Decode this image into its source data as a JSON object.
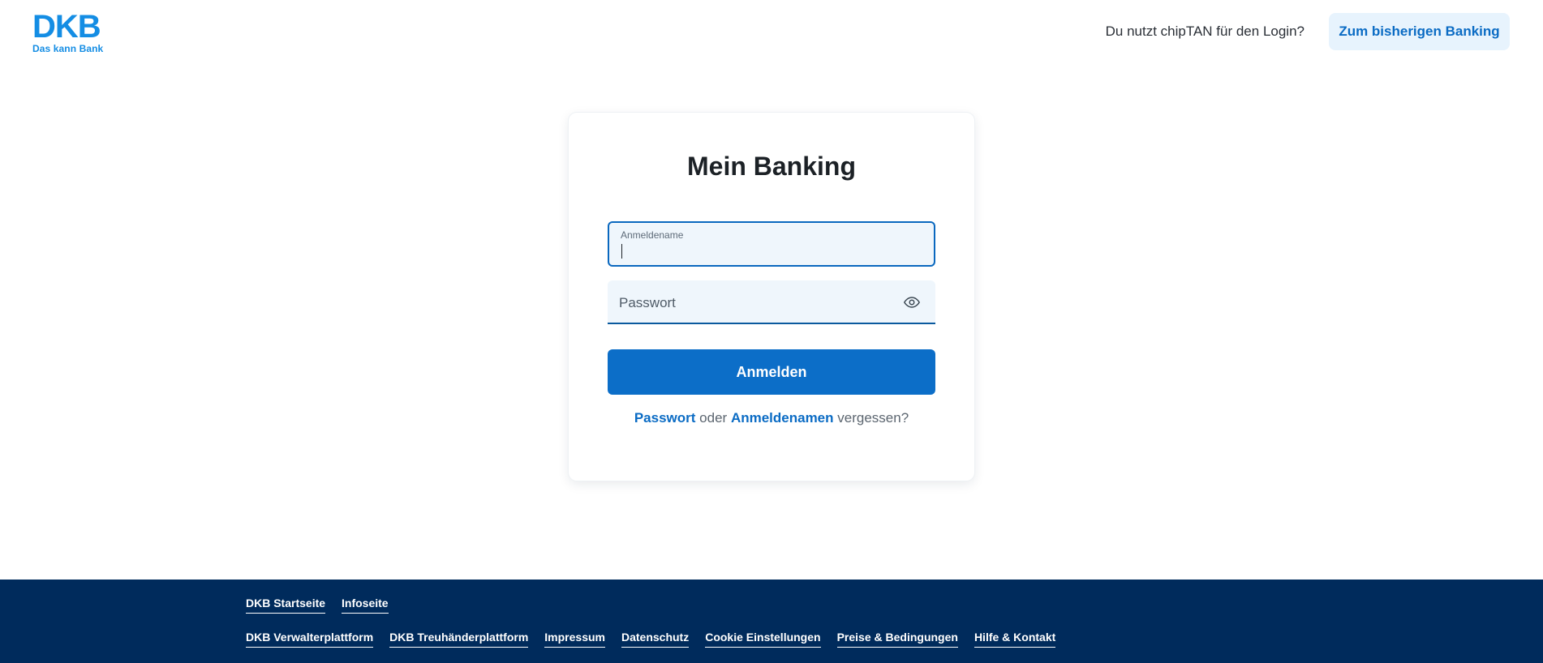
{
  "header": {
    "logo_text": "DKB",
    "logo_tagline": "Das kann Bank",
    "chiptan_question": "Du nutzt chipTAN für den Login?",
    "old_banking_button": "Zum bisherigen Banking"
  },
  "login": {
    "title": "Mein Banking",
    "username_label": "Anmeldename",
    "username_value": "",
    "password_placeholder": "Passwort",
    "submit_label": "Anmelden",
    "forgot": {
      "password_link": "Passwort",
      "middle": "oder",
      "username_link": "Anmeldenamen",
      "suffix": "vergessen?"
    }
  },
  "footer": {
    "row1": [
      {
        "label": "DKB Startseite"
      },
      {
        "label": "Infoseite"
      }
    ],
    "row2": [
      {
        "label": "DKB Verwalterplattform"
      },
      {
        "label": "DKB Treuhänderplattform"
      },
      {
        "label": "Impressum"
      },
      {
        "label": "Datenschutz"
      },
      {
        "label": "Cookie Einstellungen"
      },
      {
        "label": "Preise & Bedingungen"
      },
      {
        "label": "Hilfe & Kontakt"
      }
    ]
  },
  "colors": {
    "brand_blue": "#148de4",
    "primary_button": "#0c6ec8",
    "footer_bg": "#002b5c",
    "link_blue": "#0a6bc4"
  },
  "icons": {
    "password_toggle": "eye-icon"
  }
}
